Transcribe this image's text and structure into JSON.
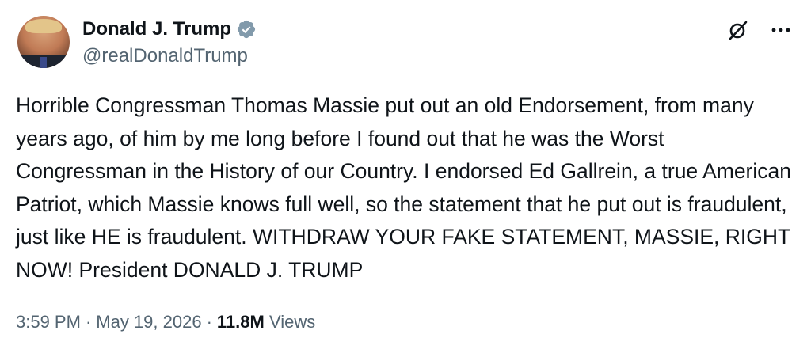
{
  "author": {
    "display_name": "Donald J. Trump",
    "handle": "@realDonaldTrump",
    "verified": true,
    "verified_color": "#829aab"
  },
  "post": {
    "text": "Horrible Congressman Thomas Massie put out an old Endorsement, from many years ago, of him by me long before I found out that he was the Worst Congressman in the History of our Country. I endorsed Ed Gallrein, a true American Patriot, which Massie knows full well, so the statement that he put out is fraudulent, just like HE is fraudulent. WITHDRAW YOUR FAKE STATEMENT, MASSIE, RIGHT NOW! President DONALD J. TRUMP"
  },
  "meta": {
    "time": "3:59 PM",
    "separator": "·",
    "date": "May 19, 2026",
    "views_count": "11.8M",
    "views_label": "Views"
  },
  "icons": {
    "avatar": "profile-photo",
    "verified": "verified-badge-icon",
    "grok": "grok-icon",
    "more": "more-options-icon"
  },
  "colors": {
    "text_primary": "#0f1419",
    "text_secondary": "#536471",
    "background": "#ffffff"
  }
}
